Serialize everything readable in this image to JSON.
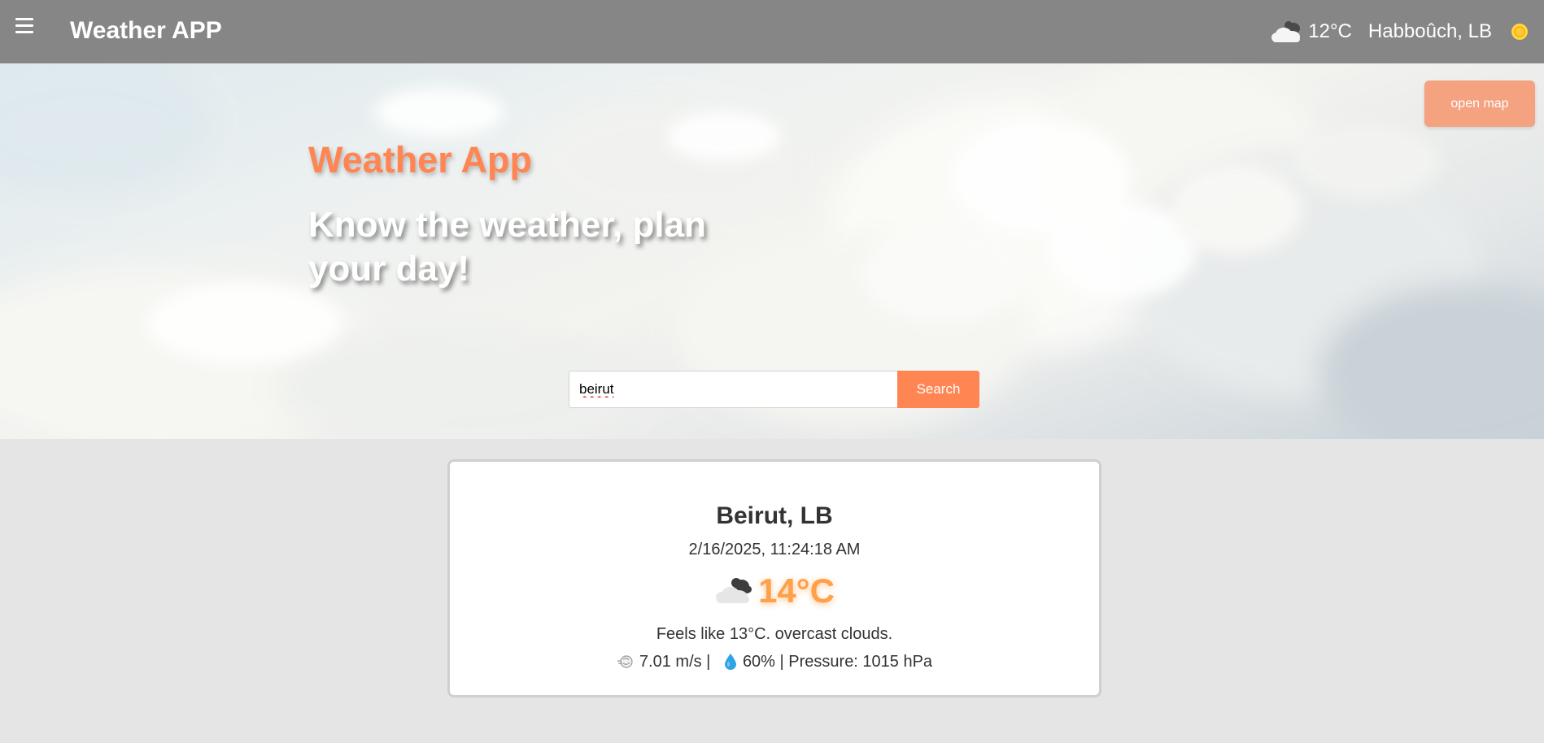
{
  "navbar": {
    "menu_icon": "hamburger-menu-icon",
    "brand": "Weather APP",
    "weather_icon": "overcast-cloud-icon",
    "temperature": "12°C",
    "location": "Habboûch, LB",
    "theme_icon": "sun-icon"
  },
  "hero": {
    "title": "Weather App",
    "tagline": "Know the weather, plan your day!",
    "open_map_label": "open map",
    "search_value": "beirut",
    "search_button_label": "Search"
  },
  "card": {
    "city": "Beirut, LB",
    "datetime": "2/16/2025, 11:24:18 AM",
    "weather_icon": "overcast-cloud-icon",
    "temperature": "14°C",
    "description": "Feels like 13°C. overcast clouds.",
    "wind_icon": "wind-icon",
    "wind_speed": "7.01 m/s",
    "separator_1": " | ",
    "humidity_icon": "water-drop-icon",
    "humidity": "60%",
    "separator_2": " | ",
    "pressure": "Pressure: 1015 hPa"
  },
  "colors": {
    "navbar_bg": "#868686",
    "accent": "#ff8553",
    "open_map_bg": "#f4a27f",
    "temp_accent": "#ffa04a",
    "page_bg": "#e5e5e5"
  }
}
